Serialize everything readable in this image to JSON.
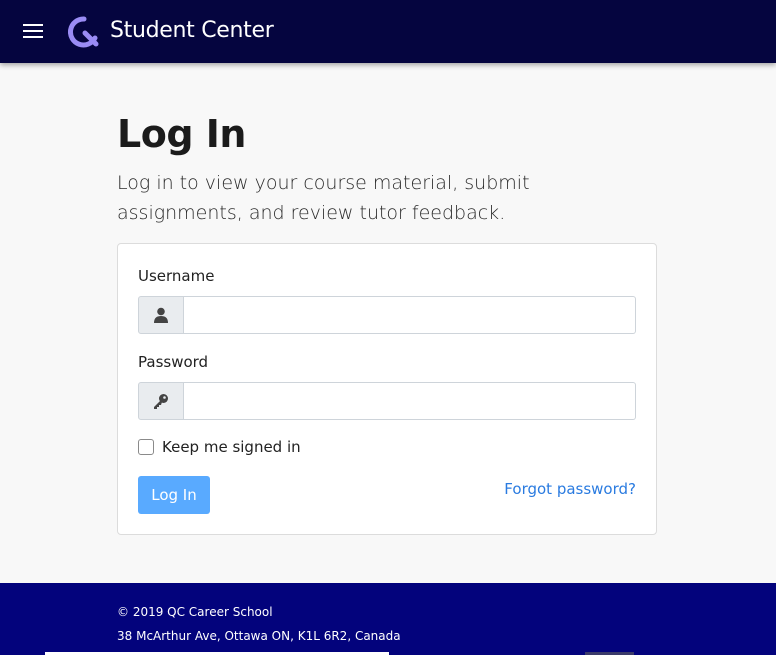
{
  "header": {
    "menu_icon": "hamburger-icon",
    "logo_icon": "qc-logo-icon",
    "title": "Student Center",
    "background": "#05053f"
  },
  "main": {
    "title": "Log In",
    "subtitle": "Log in to view your course material, submit assignments, and review tutor feedback."
  },
  "form": {
    "username_label": "Username",
    "username_icon": "user-icon",
    "username_value": "",
    "password_label": "Password",
    "password_icon": "key-icon",
    "password_value": "",
    "remember_label": "Keep me signed in",
    "remember_checked": false,
    "submit_label": "Log In",
    "forgot_label": "Forgot password?",
    "submit_color": "#59aaff",
    "link_color": "#2a7be0"
  },
  "footer": {
    "copyright": "© 2019 QC Career School",
    "address": "38 McArthur Ave, Ottawa ON, K1L 6R2, Canada",
    "background": "#03037c"
  }
}
